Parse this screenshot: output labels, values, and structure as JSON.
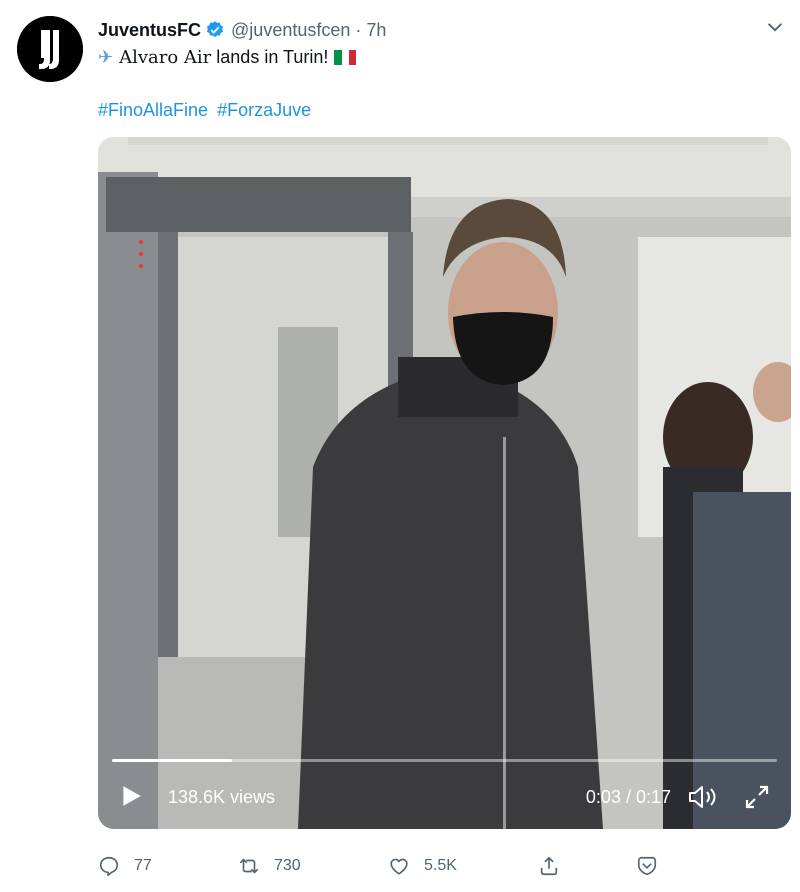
{
  "account": {
    "name": "JuventusFC",
    "handle": "@juventusfcen",
    "separator": "·",
    "time": "7h"
  },
  "tweet": {
    "icon_name": "airplane-icon",
    "text_styled": "Alvaro Air",
    "text_rest": " lands in Turin!",
    "flag": "italy-flag",
    "hashtags": [
      "#FinoAllaFine",
      "#ForzaJuve"
    ]
  },
  "video": {
    "views": "138.6K views",
    "timecode": "0:03 / 0:17",
    "progress": 0.18
  },
  "actions": {
    "reply_count": "77",
    "retweet_count": "730",
    "like_count": "5.5K"
  },
  "colors": {
    "link": "#1b95e0",
    "verified": "#1d9bf0",
    "muted": "#536471"
  }
}
